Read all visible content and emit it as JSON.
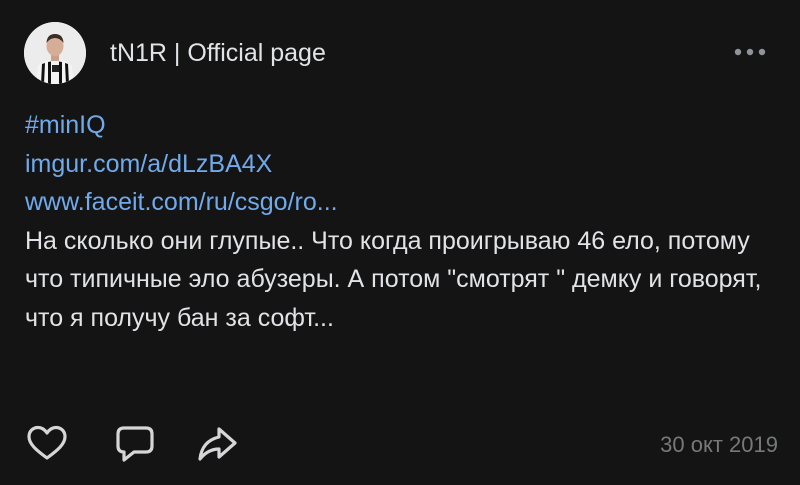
{
  "post": {
    "author": "tN1R | Official page",
    "hashtag": "#minIQ",
    "link1": "imgur.com/a/dLzBA4X",
    "link2": "www.faceit.com/ru/csgo/ro...",
    "text": "На сколько они глупые.. Что когда проигрываю 46 ело, потому что типичные эло абузеры. А потом \"смотрят \" демку и говорят, что я получу бан за софт...",
    "date": "30 окт 2019"
  },
  "icons": {
    "more": "more-horizontal-icon",
    "like": "heart-icon",
    "comment": "comment-icon",
    "share": "share-icon"
  },
  "colors": {
    "background": "#141414",
    "text": "#e1e3e6",
    "link": "#71aaeb",
    "secondary": "#76787a"
  }
}
